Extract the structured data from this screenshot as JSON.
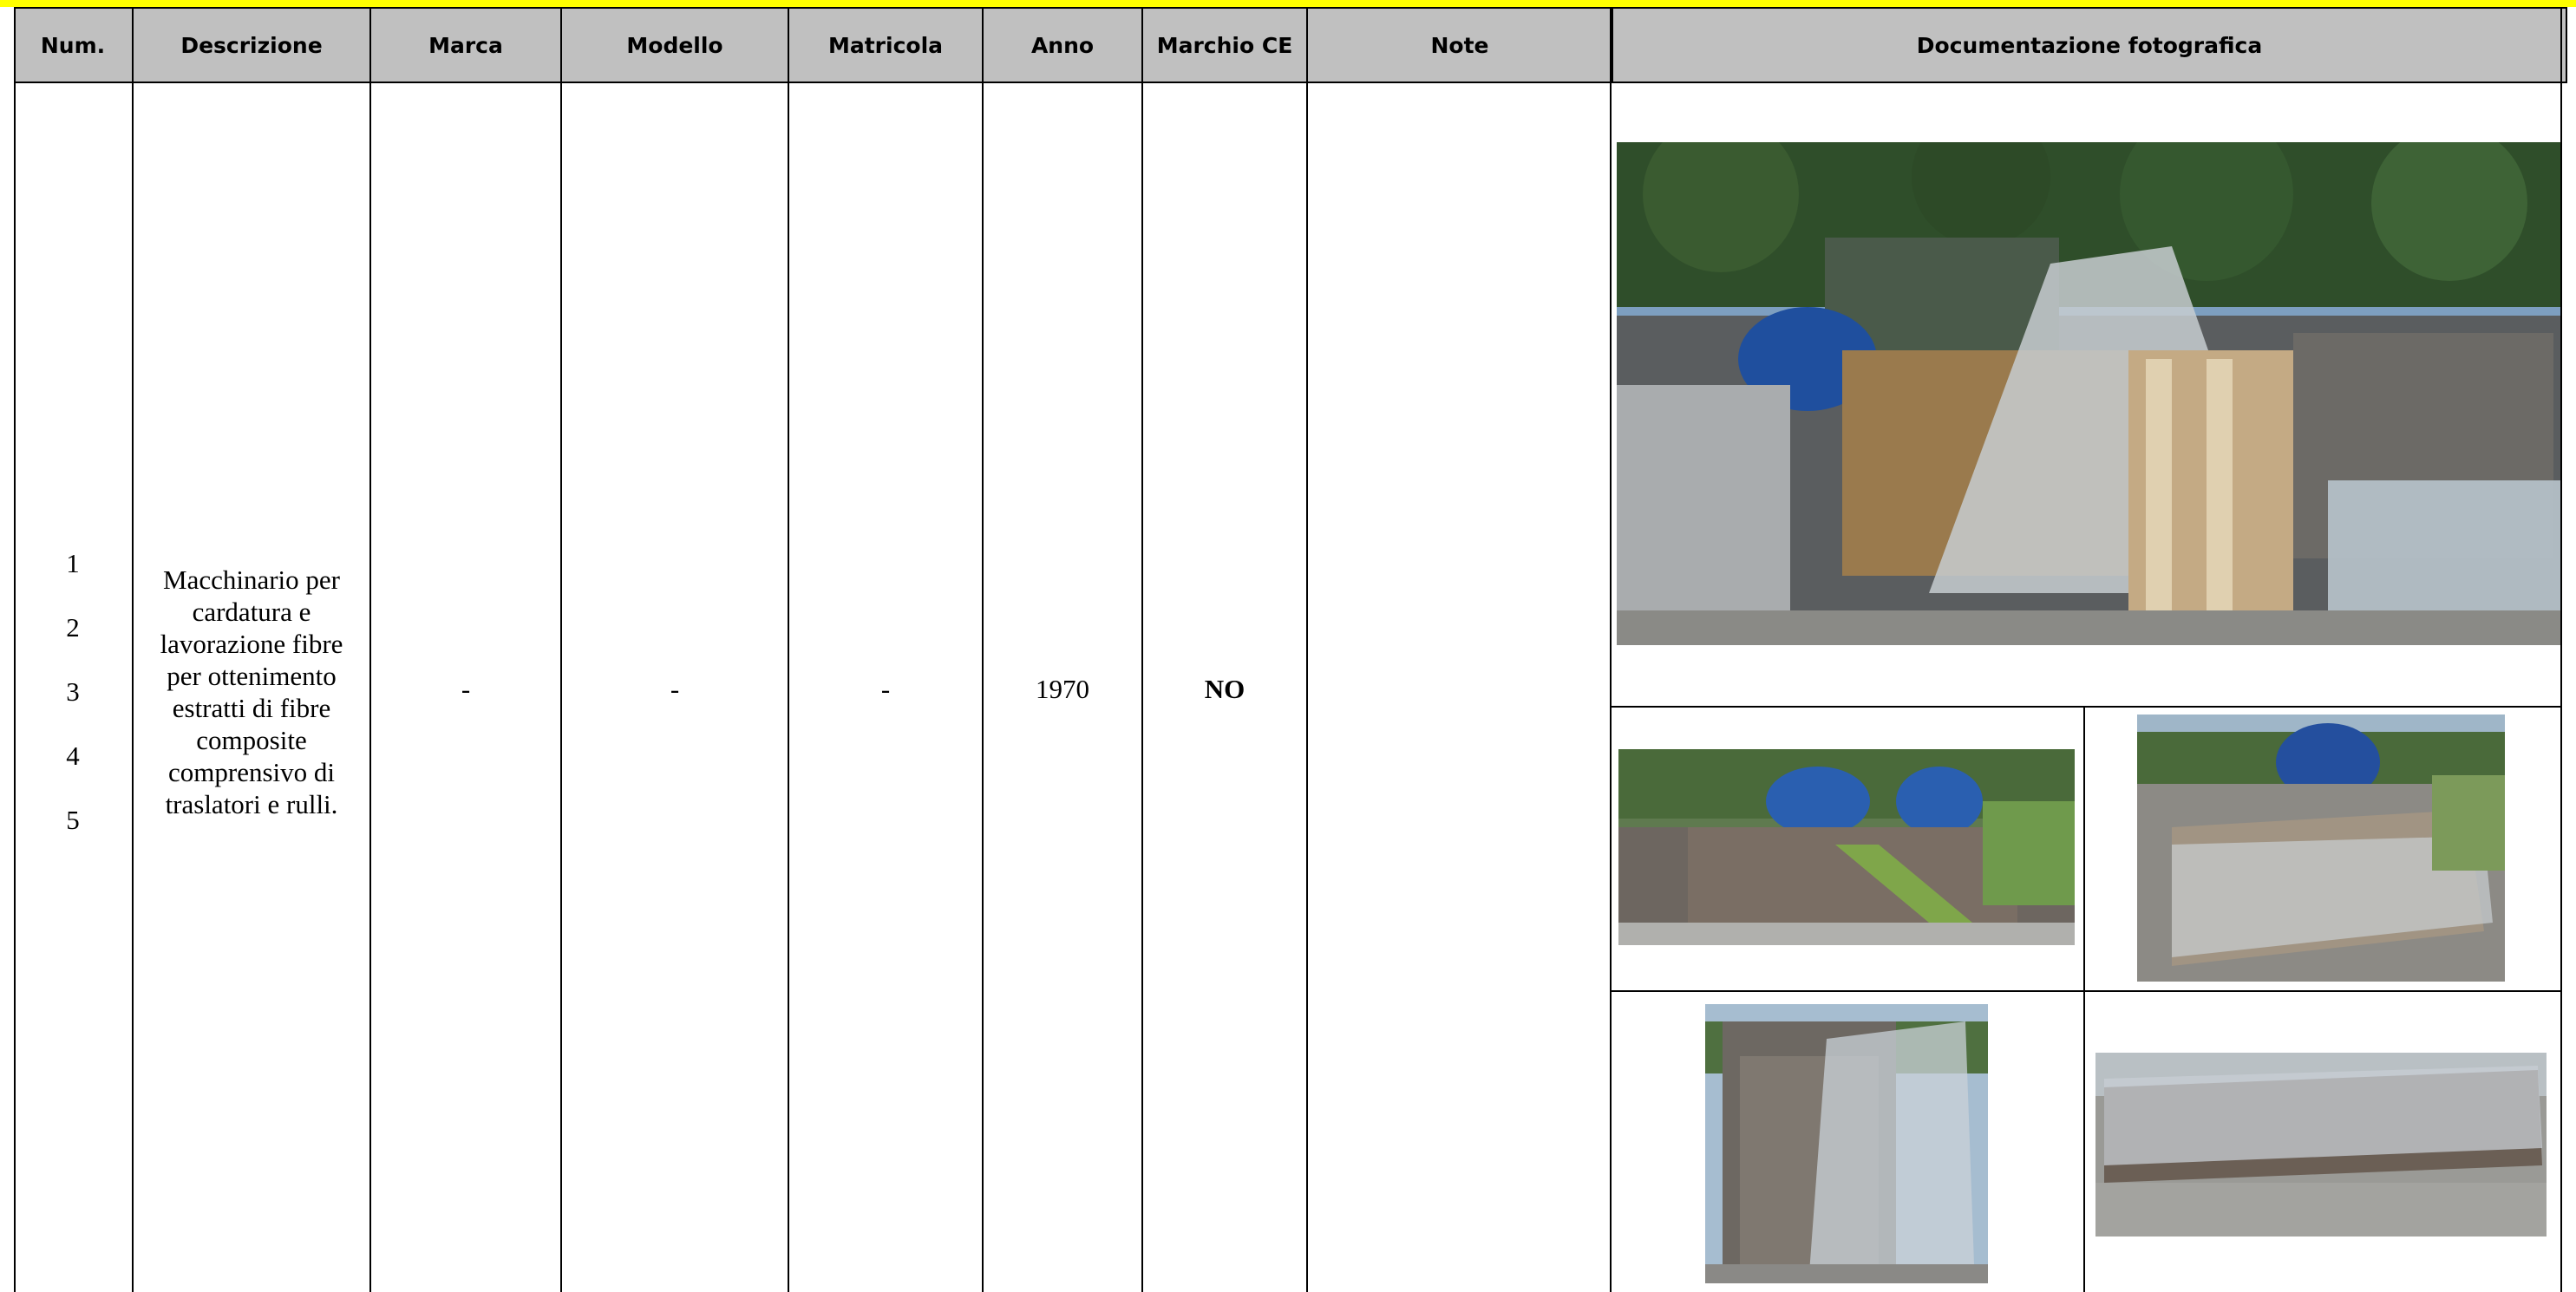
{
  "table": {
    "headers": {
      "num": "Num.",
      "descrizione": "Descrizione",
      "marca": "Marca",
      "modello": "Modello",
      "matricola": "Matricola",
      "anno": "Anno",
      "marchio_ce": "Marchio CE",
      "note": "Note",
      "documentazione": "Documentazione fotografica"
    },
    "row": {
      "numbers": [
        "1",
        "2",
        "3",
        "4",
        "5"
      ],
      "descrizione_lines": [
        "Macchinario per",
        "cardatura e",
        "lavorazione fibre",
        "per ottenimento",
        "estratti di fibre",
        "composite",
        "comprensivo di",
        "traslatori e rulli."
      ],
      "marca": "-",
      "modello": "-",
      "matricola": "-",
      "anno": "1970",
      "marchio_ce": "NO",
      "note": ""
    }
  },
  "colors": {
    "banner": "#ffff00",
    "header_bg": "#c0c0c0",
    "border": "#000000"
  }
}
